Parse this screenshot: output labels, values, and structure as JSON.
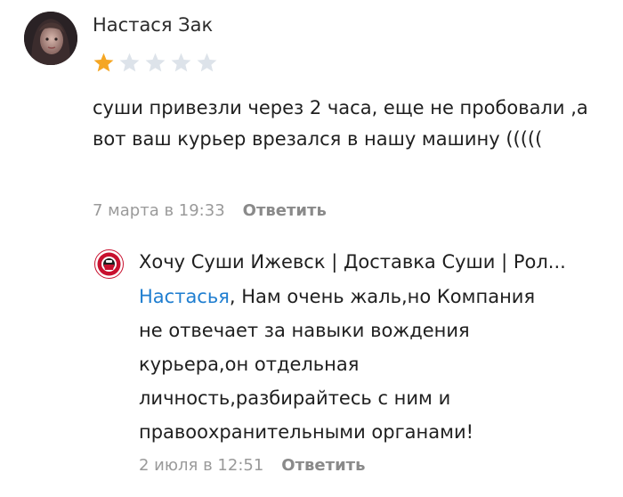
{
  "review": {
    "author": "Настася Зак",
    "rating": 1,
    "max_rating": 5,
    "text": "суши привезли через 2 часа, еще не пробовали ,а вот ваш курьер врезался в нашу машину (((((",
    "date": "7 марта в 19:33",
    "reply_label": "Ответить"
  },
  "response": {
    "company": "Хочу Суши Ижевск | Доставка Суши | Рол...",
    "mention": "Настасья",
    "text": ", Нам очень жаль,но Компания не отвечает за навыки вождения курьера,он отдельная личность,разбирайтесь с ним и правоохранительными органами!",
    "date": "2 июля в 12:51",
    "reply_label": "Ответить"
  },
  "colors": {
    "star_filled": "#f5a623",
    "star_empty": "#dde3ea",
    "link": "#1f7ed0",
    "logo_red": "#c8102e"
  }
}
